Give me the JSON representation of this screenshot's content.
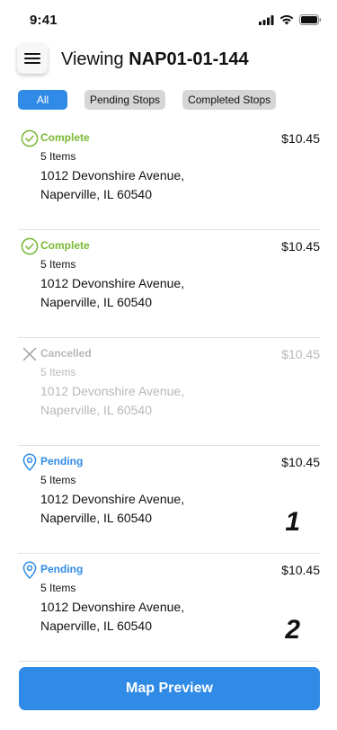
{
  "status_bar": {
    "time": "9:41",
    "icons": [
      "signal-icon",
      "wifi-icon",
      "battery-icon"
    ]
  },
  "header": {
    "menu_icon": "hamburger-menu-icon",
    "title_prefix": "Viewing",
    "order_id": "NAP01-01-144"
  },
  "filters": [
    {
      "label": "All",
      "active": true
    },
    {
      "label": "Pending Stops",
      "active": false
    },
    {
      "label": "Completed Stops",
      "active": false
    }
  ],
  "stops": [
    {
      "status": "Complete",
      "icon": "check-circle-icon",
      "items": "5 Items",
      "address_line1": "1012 Devonshire Avenue,",
      "address_line2": "Naperville, IL 60540",
      "amount": "$10.45",
      "sequence": ""
    },
    {
      "status": "Complete",
      "icon": "check-circle-icon",
      "items": "5 Items",
      "address_line1": "1012 Devonshire Avenue,",
      "address_line2": "Naperville, IL 60540",
      "amount": "$10.45",
      "sequence": ""
    },
    {
      "status": "Cancelled",
      "icon": "x-icon",
      "items": "5 Items",
      "address_line1": "1012 Devonshire Avenue,",
      "address_line2": "Naperville, IL 60540",
      "amount": "$10.45",
      "sequence": ""
    },
    {
      "status": "Pending",
      "icon": "map-pin-icon",
      "items": "5 Items",
      "address_line1": "1012 Devonshire Avenue,",
      "address_line2": "Naperville, IL 60540",
      "amount": "$10.45",
      "sequence": "1"
    },
    {
      "status": "Pending",
      "icon": "map-pin-icon",
      "items": "5 Items",
      "address_line1": "1012 Devonshire Avenue,",
      "address_line2": "Naperville, IL 60540",
      "amount": "$10.45",
      "sequence": "2"
    }
  ],
  "map_button": {
    "label": "Map Preview"
  },
  "colors": {
    "accent": "#2f8be6",
    "complete": "#7ab832",
    "pending": "#2f8be6",
    "cancelled": "#b8b8b8",
    "chip_inactive": "#d6d6d6"
  }
}
